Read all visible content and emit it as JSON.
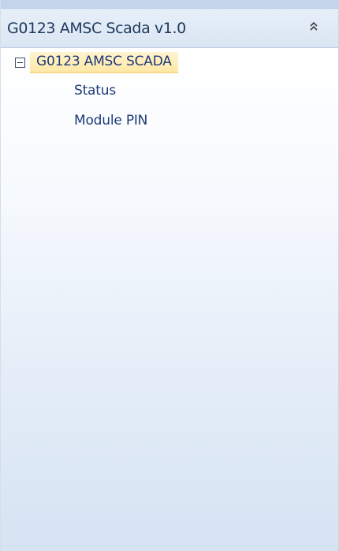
{
  "panel": {
    "title": "G0123 AMSC Scada v1.0",
    "collapse_icon": "double-chevron-up-icon"
  },
  "tree": {
    "root": {
      "label": "G0123 AMSC SCADA",
      "expander_icon": "collapse-minus-icon",
      "expanded": true,
      "selected": true,
      "children": [
        {
          "label": "Status"
        },
        {
          "label": "Module PIN"
        }
      ]
    }
  },
  "colors": {
    "header_background": "#dfe9f5",
    "title_text": "#1e395b",
    "tree_text": "#1e3a78",
    "selection_highlight": "#ffeab0",
    "panel_gradient_bottom": "#d6e3f3"
  }
}
